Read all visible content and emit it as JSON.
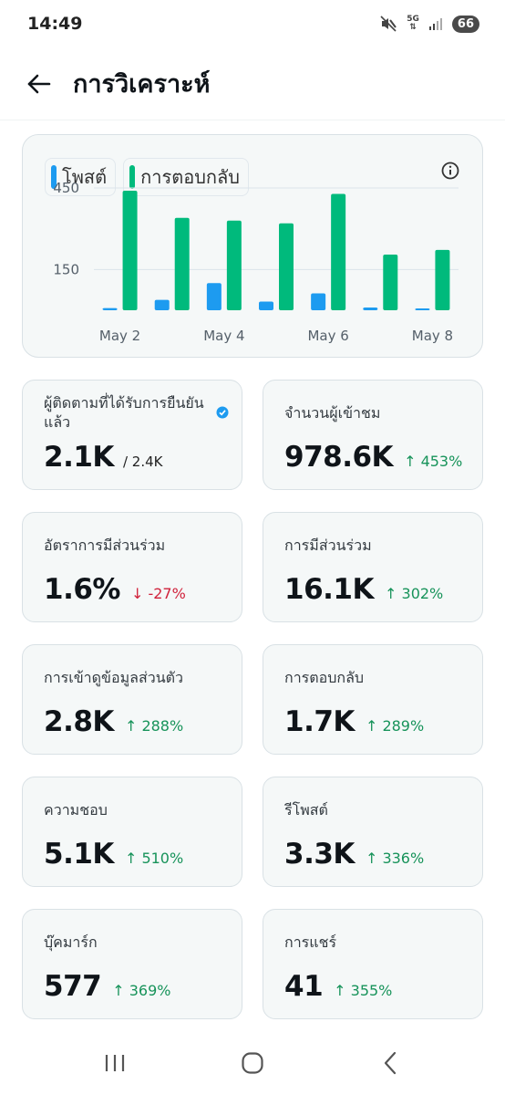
{
  "status_bar": {
    "time": "14:49",
    "network": "5G",
    "battery": "66"
  },
  "header": {
    "title": "การวิเคราะห์"
  },
  "chart": {
    "legend": [
      {
        "label": "โพสต์",
        "color": "#1d9bf0"
      },
      {
        "label": "การตอบกลับ",
        "color": "#00ba7c"
      }
    ]
  },
  "chart_data": {
    "type": "bar",
    "categories": [
      "May 2",
      "May 3",
      "May 4",
      "May 5",
      "May 6",
      "May 7",
      "May 8"
    ],
    "x_tick_labels": [
      "May 2",
      "May 4",
      "May 6",
      "May 8"
    ],
    "series": [
      {
        "name": "โพสต์",
        "color": "#1d9bf0",
        "values": [
          8,
          38,
          100,
          32,
          62,
          10,
          6
        ]
      },
      {
        "name": "การตอบกลับ",
        "color": "#00ba7c",
        "values": [
          440,
          340,
          330,
          320,
          428,
          205,
          222
        ]
      }
    ],
    "y_ticks": [
      150,
      450
    ],
    "ylim": [
      0,
      520
    ],
    "grid": true
  },
  "metrics": [
    {
      "label": "ผู้ติดตามที่ได้รับการยืนยันแล้ว",
      "value": "2.1K",
      "total": "/ 2.4K",
      "change": "",
      "direction": ""
    },
    {
      "label": "จำนวนผู้เข้าชม",
      "value": "978.6K",
      "total": "",
      "change": "↑ 453%",
      "direction": "up"
    },
    {
      "label": "อัตราการมีส่วนร่วม",
      "value": "1.6%",
      "total": "",
      "change": "↓ -27%",
      "direction": "down"
    },
    {
      "label": "การมีส่วนร่วม",
      "value": "16.1K",
      "total": "",
      "change": "↑ 302%",
      "direction": "up"
    },
    {
      "label": "การเข้าดูข้อมูลส่วนตัว",
      "value": "2.8K",
      "total": "",
      "change": "↑ 288%",
      "direction": "up"
    },
    {
      "label": "การตอบกลับ",
      "value": "1.7K",
      "total": "",
      "change": "↑ 289%",
      "direction": "up"
    },
    {
      "label": "ความชอบ",
      "value": "5.1K",
      "total": "",
      "change": "↑ 510%",
      "direction": "up"
    },
    {
      "label": "รีโพสต์",
      "value": "3.3K",
      "total": "",
      "change": "↑ 336%",
      "direction": "up"
    },
    {
      "label": "บุ๊คมาร์ก",
      "value": "577",
      "total": "",
      "change": "↑ 369%",
      "direction": "up"
    },
    {
      "label": "การแชร์",
      "value": "41",
      "total": "",
      "change": "↑ 355%",
      "direction": "up"
    }
  ]
}
